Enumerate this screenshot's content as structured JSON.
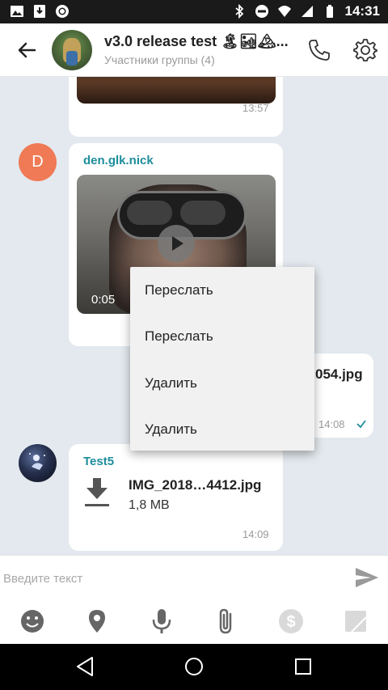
{
  "status_bar": {
    "time": "14:31"
  },
  "header": {
    "title": "v3.0 release test 🏝🏜🏔...",
    "subtitle": "Участники группы (4)"
  },
  "messages": {
    "first": {
      "time": "13:57"
    },
    "video": {
      "sender": "den.glk.nick",
      "avatar_letter": "D",
      "duration": "0:05"
    },
    "outgoing": {
      "filename_fragment": "054.jpg",
      "time": "14:08"
    },
    "file": {
      "sender": "Test5",
      "filename": "IMG_2018…4412.jpg",
      "size": "1,8 MB",
      "time": "14:09"
    }
  },
  "context_menu": {
    "items": [
      "Переслать",
      "Переслать",
      "Удалить",
      "Удалить"
    ]
  },
  "composer": {
    "placeholder": "Введите текст"
  },
  "colors": {
    "accent": "#1d8d9c",
    "avatar_orange": "#ef7a55",
    "chat_bg": "#e3e9ee"
  }
}
